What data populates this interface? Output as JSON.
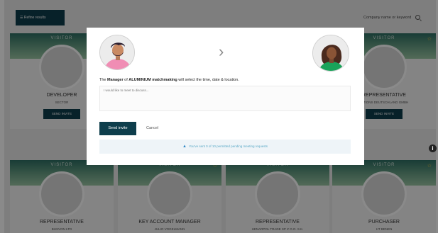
{
  "topbar": {
    "refine_label": "☰ Refine results",
    "search_placeholder": "Company name or keyword"
  },
  "cards_top": [
    {
      "tag": "VISITOR",
      "role": "DEVELOPER",
      "sub": "SECTOR",
      "button": "SEND INVITE"
    },
    {
      "tag": "VISITOR",
      "role": "REPRESENTATIVE",
      "sub": "...ITIONS DEUTSCHLAND GMBH",
      "button": "SEND INVITE"
    }
  ],
  "cards_bottom": [
    {
      "tag": "VISITOR",
      "role": "REPRESENTATIVE",
      "sub": "BUSVON LTD"
    },
    {
      "tag": "VISITOR",
      "role": "KEY ACCOUNT MANAGER",
      "sub": "JULIO VOGELMANN"
    },
    {
      "tag": "VISITOR",
      "role": "REPRESENTATIVE",
      "sub": "HENARPOL TRADE SP Z O.O. S.K."
    },
    {
      "tag": "VISITOR",
      "role": "PURCHASER",
      "sub": "HT BENEN"
    }
  ],
  "modal": {
    "statement_prefix": "The ",
    "statement_role": "Manager",
    "statement_mid": " of ",
    "statement_company": "ALUMINIUM matchmaking",
    "statement_suffix": " will select the time, date & location.",
    "message_placeholder": "I would like to meet to discuss...",
    "send_label": "Send invite",
    "cancel_label": "Cancel",
    "notice_text": "You've sent 0 of 10 permitted pending meeting requests"
  },
  "colors": {
    "primary": "#0e3e4c",
    "notice_bg": "#eef4f8",
    "notice_text": "#5aa9c6",
    "overlay": "rgba(0,0,0,0.46)"
  },
  "icons": {
    "chevron": "chevron-right-icon",
    "info": "info-icon",
    "search": "search-icon",
    "warning": "warning-icon",
    "star": "star-icon"
  }
}
